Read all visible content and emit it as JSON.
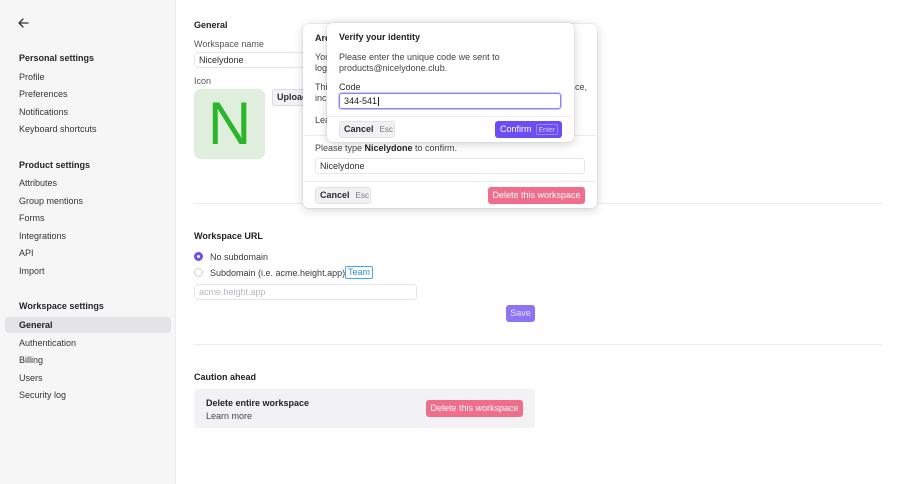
{
  "sidebar": {
    "back_icon": "arrow-left-icon",
    "sections": [
      {
        "title": "Personal settings",
        "items": [
          "Profile",
          "Preferences",
          "Notifications",
          "Keyboard shortcuts"
        ]
      },
      {
        "title": "Product settings",
        "items": [
          "Attributes",
          "Group mentions",
          "Forms",
          "Integrations",
          "API",
          "Import"
        ]
      },
      {
        "title": "Workspace settings",
        "items": [
          "General",
          "Authentication",
          "Billing",
          "Users",
          "Security log"
        ]
      }
    ],
    "active_item": "General"
  },
  "general": {
    "heading": "General",
    "name_label": "Workspace name",
    "name_value": "Nicelydone",
    "icon_label": "Icon",
    "icon_letter": "N",
    "upload_label": "Upload"
  },
  "url": {
    "heading": "Workspace URL",
    "options": [
      {
        "label": "No subdomain",
        "selected": true
      },
      {
        "label": "Subdomain (i.e. acme.height.app)",
        "selected": false
      }
    ],
    "badge": "Team",
    "placeholder": "acme.height.app",
    "save_label": "Save"
  },
  "caution": {
    "heading": "Caution ahead",
    "title": "Delete entire workspace",
    "link": "Learn more",
    "button": "Delete this workspace"
  },
  "delete_modal": {
    "title_fragment": "Are",
    "line1_fragment": "You",
    "line2_fragment": "log",
    "line3_fragment": "Thi",
    "line3_tail": "ce,",
    "line4_fragment": "inc",
    "learn_fragment": "Lea",
    "confirm_prefix": "Please type ",
    "confirm_word": "Nicelydone",
    "confirm_suffix": " to confirm.",
    "input_value": "Nicelydone",
    "cancel_label": "Cancel",
    "cancel_key": "Esc",
    "delete_label": "Delete this workspace"
  },
  "verify_modal": {
    "title": "Verify your identity",
    "line1": "Please enter the unique code we sent to",
    "line2": "products@nicelydone.club.",
    "code_label": "Code",
    "code_value": "344-541",
    "cancel_label": "Cancel",
    "cancel_key": "Esc",
    "confirm_label": "Confirm",
    "confirm_key": "Enter"
  },
  "colors": {
    "accent": "#6b4cf5",
    "danger": "#f06d8c",
    "badge": "#45a7f0",
    "icon_green": "#2bb52b"
  }
}
